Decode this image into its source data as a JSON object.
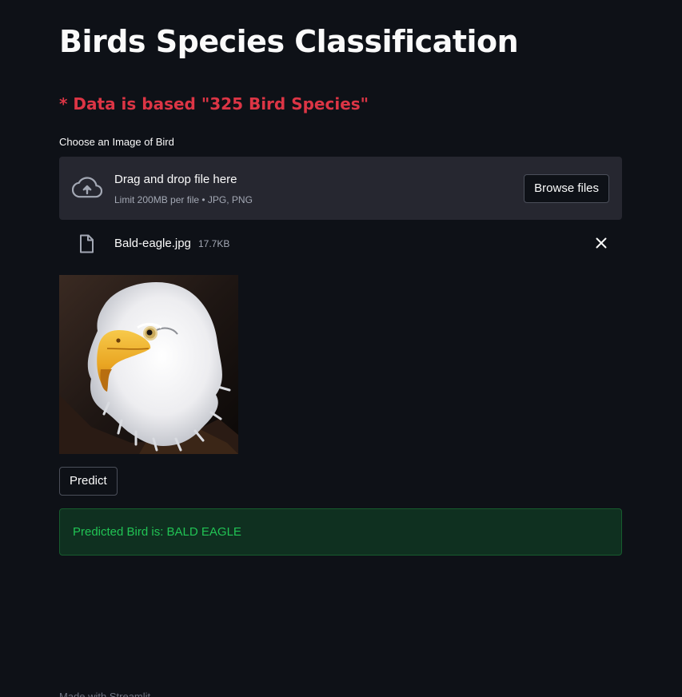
{
  "page": {
    "title": "Birds Species Classification",
    "subtitle": "* Data is based \"325 Bird Species\""
  },
  "uploader": {
    "label": "Choose an Image of Bird",
    "drop_text": "Drag and drop file here",
    "limit_text": "Limit 200MB per file • JPG, PNG",
    "browse_label": "Browse files",
    "upload_icon": "cloud-upload-icon"
  },
  "file": {
    "name": "Bald-eagle.jpg",
    "size": "17.7KB",
    "icon": "file-icon",
    "remove_icon": "close-icon"
  },
  "image": {
    "subject": "bald eagle head photo"
  },
  "actions": {
    "predict_label": "Predict"
  },
  "result": {
    "text": "Predicted Bird is: BALD EAGLE"
  },
  "footer": {
    "text": "Made with Streamlit"
  },
  "colors": {
    "background": "#0e1117",
    "accent_red": "#dc3545",
    "success_text": "#21c354",
    "success_bg": "#0f3020"
  }
}
